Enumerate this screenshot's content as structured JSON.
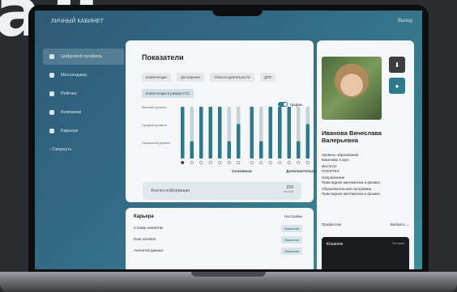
{
  "background_word": "аЛ",
  "app": {
    "logo": "ЛИЧНЫЙ КАБИНЕТ",
    "logout": "Выход"
  },
  "sidebar": {
    "items": [
      {
        "label": "Цифровой профиль",
        "active": true
      },
      {
        "label": "Мессенджер",
        "active": false
      },
      {
        "label": "Рейтинг",
        "active": false
      },
      {
        "label": "Компании",
        "active": false
      },
      {
        "label": "Карьера",
        "active": false
      }
    ],
    "back": "Свернуть"
  },
  "indicators": {
    "title": "Показатели",
    "chips": [
      {
        "label": "Компетенции",
        "selected": false
      },
      {
        "label": "Достижения",
        "selected": false
      },
      {
        "label": "Области деятельности",
        "selected": false
      },
      {
        "label": "ДПО",
        "selected": false
      },
      {
        "label": "Компетенции в рамках FCS",
        "selected": true
      }
    ],
    "toggle_label": "График",
    "y_levels": [
      "Высокий уровень",
      "Средний уровень",
      "Начальный уровень"
    ],
    "groups": [
      "Основные",
      "Дополнительные"
    ]
  },
  "chart_data": {
    "type": "bar",
    "groups": [
      {
        "name": "Основные",
        "values": [
          3,
          1,
          3,
          3,
          3,
          1,
          2
        ]
      },
      {
        "name": "Дополнительные",
        "values": [
          3,
          1,
          3,
          3,
          3,
          1,
          2
        ]
      }
    ]
  },
  "analysis": {
    "label": "Анализ информации",
    "value": "210",
    "unit": "баллов"
  },
  "career": {
    "title": "Карьера",
    "settings": "Настройки",
    "rows": [
      {
        "name": "Стажер аналитик",
        "badge": "Вакансия"
      },
      {
        "name": "Data scientist",
        "badge": "Вакансия"
      },
      {
        "name": "Аналитик данных",
        "badge": "Вакансия"
      }
    ]
  },
  "profile": {
    "name": "Иванова Вячеслава Валерьевна",
    "edu_level_label": "Уровень образования",
    "edu_level": "Бакалавр 4 курс",
    "institute_label": "Институт",
    "institute": "ПОЛИТЕХ",
    "direction_label": "Направление",
    "direction": "Прикладная математика и физика",
    "program_label": "Образовательная программа",
    "program": "Прикладная математика и физика",
    "professions": "Профессии",
    "choose": "Выбрать",
    "wallet": "Кошелек",
    "wallet_history": "История"
  },
  "colors": {
    "accent": "#2b7b8d",
    "bar_light": "#c5d3d7",
    "bar_dark": "#2b7b8d"
  }
}
